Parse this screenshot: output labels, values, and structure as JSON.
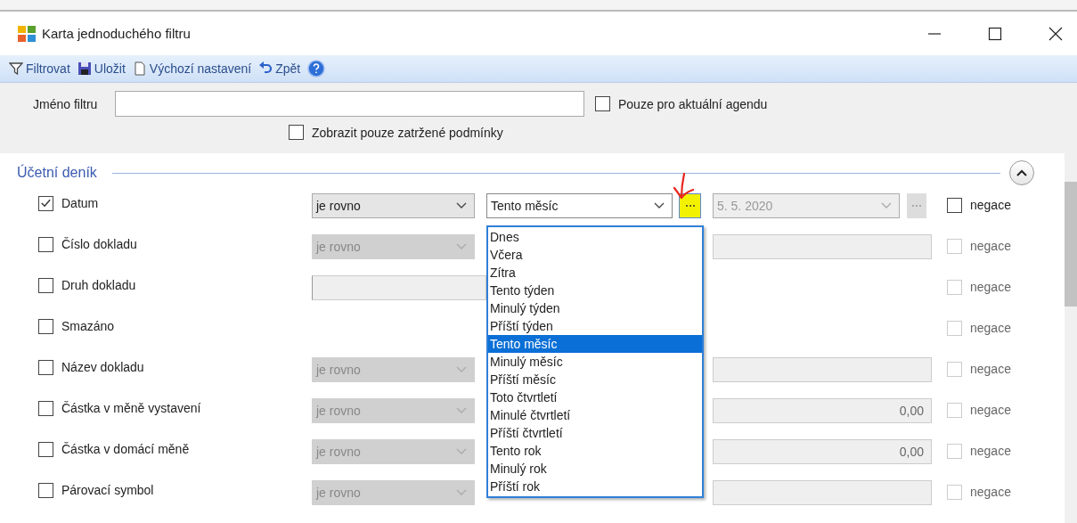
{
  "window": {
    "title": "Karta jednoduchého filtru"
  },
  "toolbar": [
    {
      "kind": "filter",
      "label": "Filtrovat"
    },
    {
      "kind": "save",
      "label": "Uložit"
    },
    {
      "kind": "default",
      "label": "Výchozí nastavení"
    },
    {
      "kind": "undo",
      "label": "Zpět"
    },
    {
      "kind": "help"
    }
  ],
  "filter_name": {
    "label": "Jméno filtru"
  },
  "only_current_agenda": {
    "label": "Pouze pro aktuální agendu",
    "checked": false
  },
  "only_checked": {
    "label": "Zobrazit pouze zatržené podmínky",
    "checked": false
  },
  "section": {
    "title": "Účetní deník",
    "expanded": true
  },
  "rows": [
    {
      "kind": "date",
      "label": "Datum",
      "checked": true,
      "operator": {
        "text": "je rovno",
        "disabled": false
      },
      "value": "Tento měsíc",
      "date": "5. 5. 2020",
      "negace": {
        "label": "negace",
        "checked": false,
        "disabled": false
      }
    },
    {
      "kind": "text",
      "label": "Číslo dokladu",
      "checked": false,
      "operator": {
        "text": "je rovno",
        "disabled": true
      },
      "negace": {
        "label": "negace",
        "checked": false,
        "disabled": true
      }
    },
    {
      "kind": "list",
      "label": "Druh dokladu",
      "checked": false,
      "negace": {
        "label": "negace",
        "checked": false,
        "disabled": true
      }
    },
    {
      "kind": "flag",
      "label": "Smazáno",
      "checked": false,
      "negace": {
        "label": "negace",
        "checked": false,
        "disabled": true
      }
    },
    {
      "kind": "text",
      "label": "Název dokladu",
      "checked": false,
      "operator": {
        "text": "je rovno",
        "disabled": true
      },
      "negace": {
        "label": "negace",
        "checked": false,
        "disabled": true
      }
    },
    {
      "kind": "amount",
      "label": "Částka v měně vystavení",
      "checked": false,
      "operator": {
        "text": "je rovno",
        "disabled": true
      },
      "amount": "0,00",
      "negace": {
        "label": "negace",
        "checked": false,
        "disabled": true
      }
    },
    {
      "kind": "amount",
      "label": "Částka v domácí měně",
      "checked": false,
      "operator": {
        "text": "je rovno",
        "disabled": true
      },
      "amount": "0,00",
      "negace": {
        "label": "negace",
        "checked": false,
        "disabled": true
      }
    },
    {
      "kind": "text",
      "label": "Párovací symbol",
      "checked": false,
      "operator": {
        "text": "je rovno",
        "disabled": true
      },
      "negace": {
        "label": "negace",
        "checked": false,
        "disabled": true
      }
    }
  ],
  "period_list": [
    {
      "label": "Dnes",
      "selected": false
    },
    {
      "label": "Včera",
      "selected": false
    },
    {
      "label": "Zítra",
      "selected": false
    },
    {
      "label": "Tento týden",
      "selected": false
    },
    {
      "label": "Minulý týden",
      "selected": false
    },
    {
      "label": "Příští týden",
      "selected": false
    },
    {
      "label": "Tento měsíc",
      "selected": true
    },
    {
      "label": "Minulý měsíc",
      "selected": false
    },
    {
      "label": "Příští měsíc",
      "selected": false
    },
    {
      "label": "Toto čtvrtletí",
      "selected": false
    },
    {
      "label": "Minulé čtvrtletí",
      "selected": false
    },
    {
      "label": "Příští čtvrtletí",
      "selected": false
    },
    {
      "label": "Tento rok",
      "selected": false
    },
    {
      "label": "Minulý rok",
      "selected": false
    },
    {
      "label": "Příští rok",
      "selected": false
    }
  ]
}
